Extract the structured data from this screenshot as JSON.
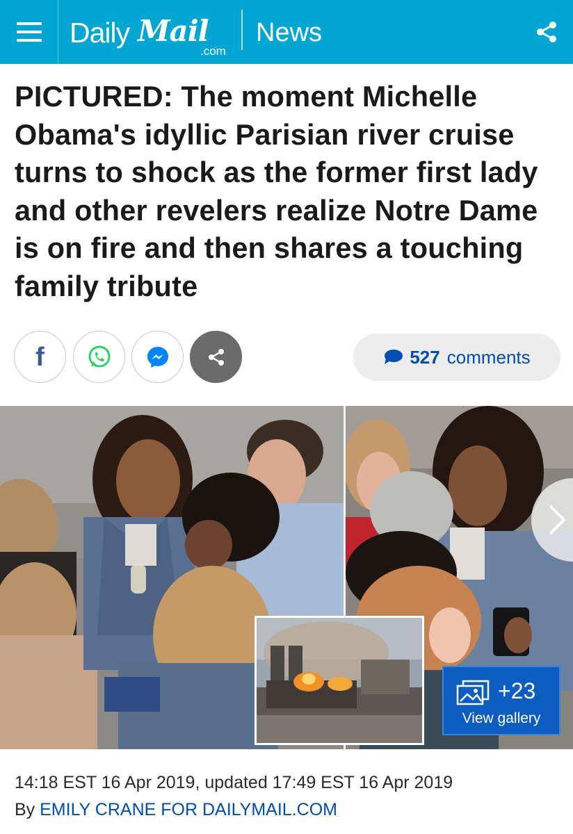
{
  "header": {
    "brand_daily": "Daily",
    "brand_mail": "Mail",
    "brand_com": ".com",
    "section": "News",
    "bg_color": "#00a6d2"
  },
  "icons": {
    "menu": "hamburger-menu-icon",
    "share": "share-icon",
    "facebook": "facebook-icon",
    "whatsapp": "whatsapp-icon",
    "messenger": "messenger-icon",
    "more_share": "share-icon",
    "comment": "comment-bubble-icon",
    "gallery": "gallery-icon",
    "next": "chevron-right-icon"
  },
  "article": {
    "headline": "PICTURED: The moment Michelle Obama's idyllic Parisian river cruise turns to shock as the former first lady and other revelers realize Notre Dame is on fire and then shares a touching family tribute",
    "share": {
      "facebook_label": "f"
    },
    "comments": {
      "count": "527",
      "label": "comments"
    },
    "gallery": {
      "count": "+23",
      "label": "View gallery"
    },
    "timestamp": "14:18 EST 16 Apr 2019, updated 17:49 EST 16 Apr 2019",
    "byline_prefix": "By ",
    "author": "EMILY CRANE FOR DAILYMAIL.COM"
  },
  "colors": {
    "link": "#004db3",
    "facebook": "#3b5998",
    "whatsapp": "#25d366",
    "messenger": "#0084ff",
    "gallery_bg": "#0b5dc2"
  }
}
